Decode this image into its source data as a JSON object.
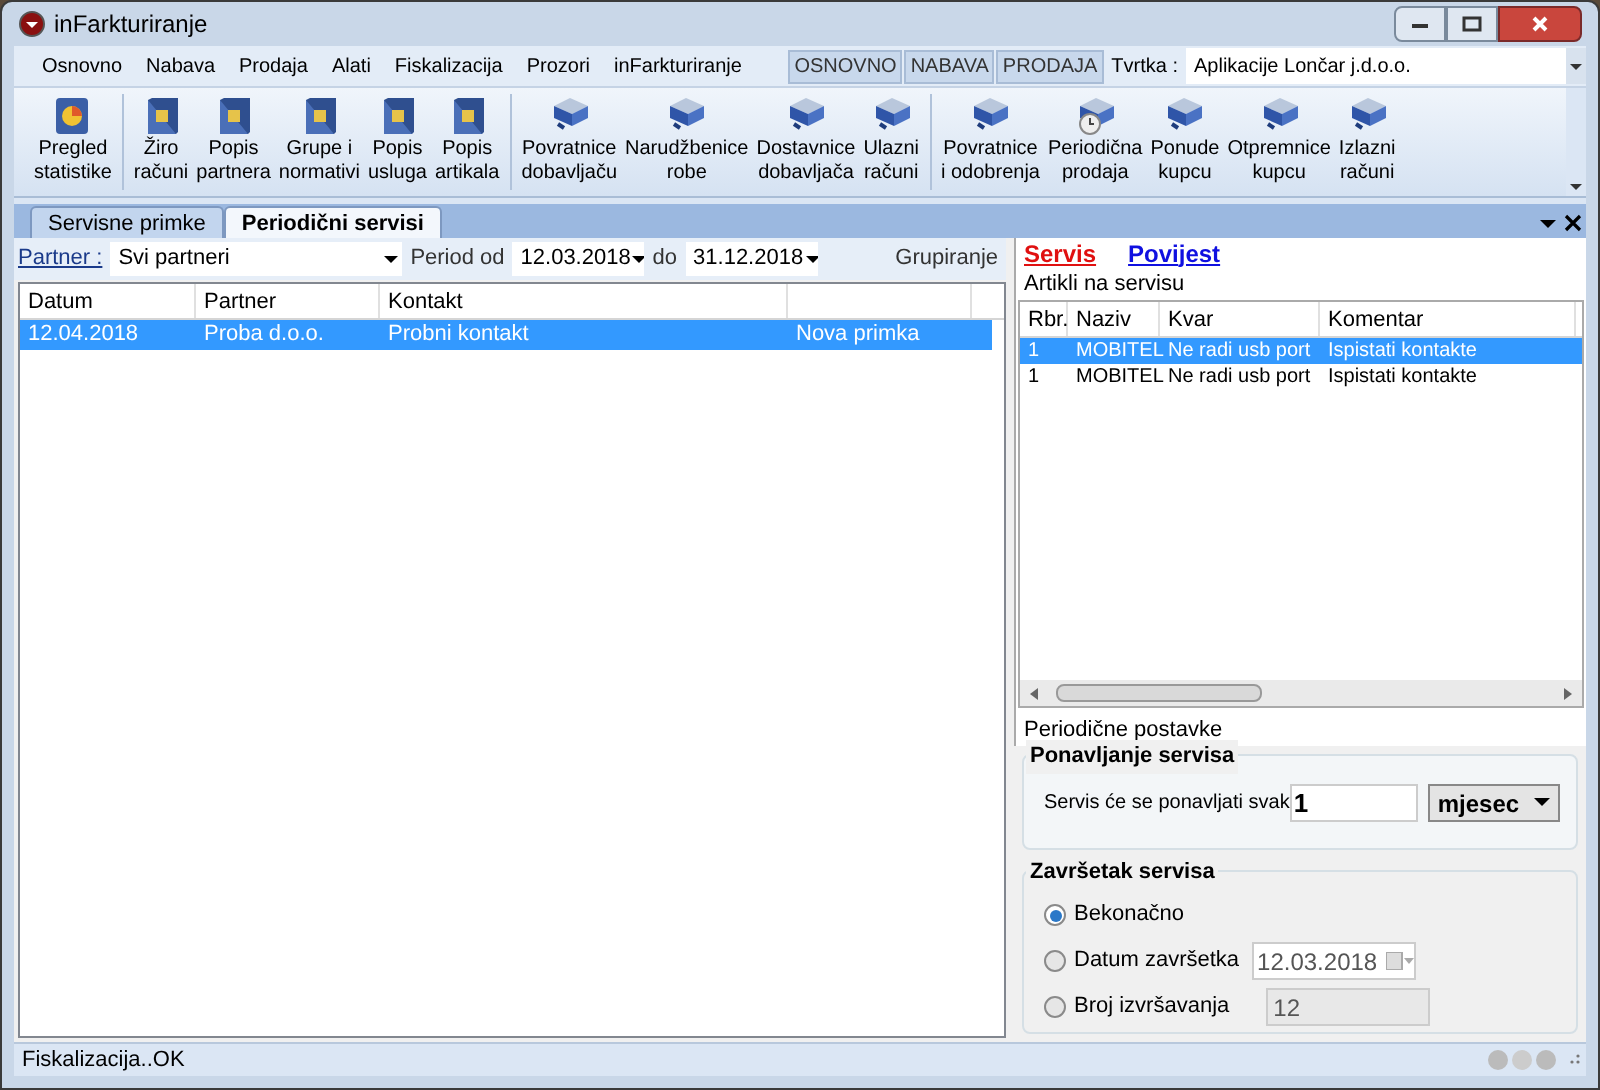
{
  "window": {
    "title": "inFarkturiranje"
  },
  "menu": [
    "Osnovno",
    "Nabava",
    "Prodaja",
    "Alati",
    "Fiskalizacija",
    "Prozori",
    "inFarkturiranje"
  ],
  "quick_tabs": [
    {
      "label": "OSNOVNO",
      "selected": false
    },
    {
      "label": "NABAVA",
      "selected": false
    },
    {
      "label": "PRODAJA",
      "selected": false
    }
  ],
  "company": {
    "label": "Tvrtka :",
    "value": "Aplikacije Lončar j.d.o.o."
  },
  "toolbar_groups": [
    [
      {
        "kind": "chart",
        "label": "Pregled\nstatistike"
      }
    ],
    [
      {
        "kind": "book",
        "label": "Žiro\nračuni"
      },
      {
        "kind": "book",
        "label": "Popis\npartnera"
      },
      {
        "kind": "book",
        "label": "Grupe i\nnormativi"
      },
      {
        "kind": "book",
        "label": "Popis\nusluga"
      },
      {
        "kind": "book",
        "label": "Popis\nartikala"
      }
    ],
    [
      {
        "kind": "delivery",
        "label": "Povratnice\ndobavljaču"
      },
      {
        "kind": "delivery",
        "label": "Narudžbenice\nrobe"
      },
      {
        "kind": "delivery",
        "label": "Dostavnice\ndobavljača"
      },
      {
        "kind": "delivery",
        "label": "Ulazni\nračuni"
      }
    ],
    [
      {
        "kind": "delivery",
        "label": "Povratnice\ni odobrenja"
      },
      {
        "kind": "delivery-clock",
        "label": "Periodična\nprodaja"
      },
      {
        "kind": "delivery",
        "label": "Ponude\nkupcu"
      },
      {
        "kind": "delivery",
        "label": "Otpremnice\nkupcu"
      },
      {
        "kind": "delivery",
        "label": "Izlazni\nračuni"
      }
    ]
  ],
  "doc_tabs": [
    {
      "label": "Servisne primke",
      "selected": false
    },
    {
      "label": "Periodični servisi",
      "selected": true
    }
  ],
  "filters": {
    "partner_label": "Partner :",
    "partner": "Svi partneri",
    "period_from_label": "Period od",
    "period_from": "12.03.2018",
    "period_to_label": "do",
    "period_to": "31.12.2018",
    "grouping": "Grupiranje"
  },
  "list": {
    "columns": [
      "Datum",
      "Partner",
      "Kontakt"
    ],
    "rows": [
      {
        "datum": "12.04.2018",
        "partner": "Proba d.o.o.",
        "kontakt": "Probni kontakt",
        "column_4": "Nova primka",
        "selected": true
      }
    ]
  },
  "right_tabs": [
    {
      "label": "Servis",
      "selected": true
    },
    {
      "label": "Povijest",
      "selected": false
    }
  ],
  "articles": {
    "title": "Artikli na servisu",
    "columns": [
      "Rbr.",
      "Naziv",
      "Kvar",
      "Komentar"
    ],
    "rows": [
      {
        "cells": [
          "1",
          "MOBITEL",
          "Ne radi usb port",
          "Ispistati kontakte"
        ],
        "selected": true
      },
      {
        "cells": [
          "1",
          "MOBITEL",
          "Ne radi usb port",
          "Ispistati kontakte"
        ],
        "selected": false
      }
    ]
  },
  "periodic": {
    "title": "Periodične postavke",
    "repeat_group": "Ponavljanje servisa",
    "repeat_label": "Servis će se ponavljati svak",
    "repeat_value": "1",
    "repeat_unit": "mjesec",
    "end_group": "Završetak servisa",
    "end_options": [
      {
        "label": "Bekonačno",
        "selected": true
      },
      {
        "label": "Datum završetka",
        "selected": false,
        "value": "12.03.2018",
        "kind": "date"
      },
      {
        "label": "Broj izvršavanja",
        "selected": false,
        "value": "12",
        "kind": "number"
      }
    ]
  },
  "status_bar": "Fiskalizacija..OK"
}
